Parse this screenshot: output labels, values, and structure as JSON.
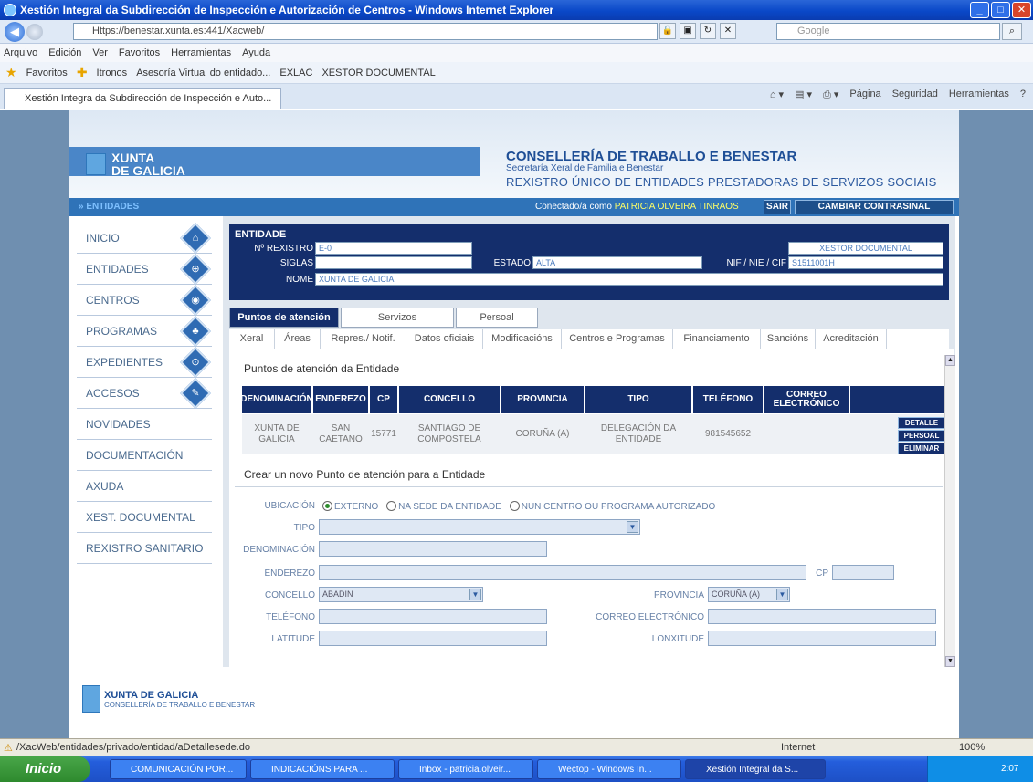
{
  "window": {
    "title": "Xestión Integral da Subdirección de Inspección e Autorización de Centros - Windows Internet Explorer"
  },
  "browser": {
    "url": "Https://benestar.xunta.es:441/Xacweb/",
    "search_placeholder": "Google",
    "menu": [
      "Arquivo",
      "Edición",
      "Ver",
      "Favoritos",
      "Herramientas",
      "Ayuda"
    ],
    "favorites_label": "Favoritos",
    "favorites": [
      "Itronos",
      "Asesoría Virtual do entidado...",
      "EXLAC",
      "XESTOR DOCUMENTAL"
    ],
    "tab_title": "Xestión Integra da Subdirección de Inspección e Auto...",
    "commands": [
      "Página",
      "Seguridad",
      "Herramientas"
    ],
    "status_url": "/XacWeb/entidades/privado/entidad/aDetallesede.do",
    "status_zone": "Internet",
    "status_zoom": "100%"
  },
  "header": {
    "logo_line1": "XUNTA",
    "logo_line2": "DE GALICIA",
    "conselleria": "CONSELLERÍA DE TRABALLO E BENESTAR",
    "secretaria": "Secretaría Xeral de Familia e Benestar",
    "rexistro": "REXISTRO ÚNICO DE ENTIDADES PRESTADORAS DE SERVIZOS SOCIAIS"
  },
  "bluebar": {
    "crumb": "» ENTIDADES",
    "connected_label": "Conectado/a como",
    "user": "PATRICIA OLVEIRA TINRAOS",
    "logout": "SAIR",
    "change_password": "CAMBIAR CONTRASINAL"
  },
  "left_menu": [
    {
      "label": "INICIO",
      "icon": "⌂"
    },
    {
      "label": "ENTIDADES",
      "icon": "⊕"
    },
    {
      "label": "CENTROS",
      "icon": "◉"
    },
    {
      "label": "PROGRAMAS",
      "icon": "♣"
    },
    {
      "label": "EXPEDIENTES",
      "icon": "⊙"
    },
    {
      "label": "ACCESOS",
      "icon": "✎"
    },
    {
      "label": "NOVIDADES",
      "icon": ""
    },
    {
      "label": "DOCUMENTACIÓN",
      "icon": ""
    },
    {
      "label": "AXUDA",
      "icon": ""
    },
    {
      "label": "XEST. DOCUMENTAL",
      "icon": ""
    },
    {
      "label": "REXISTRO SANITARIO",
      "icon": ""
    }
  ],
  "entidade": {
    "title": "ENTIDADE",
    "nrexistro_label": "Nº REXISTRO",
    "nrexistro": "E-0",
    "siglas_label": "SIGLAS",
    "siglas": "",
    "estado_label": "ESTADO",
    "estado": "ALTA",
    "nome_label": "NOME",
    "nome": "XUNTA DE GALICIA",
    "nif_label": "NIF / NIE / CIF",
    "nif": "S1511001H",
    "xestor_label": "XESTOR DOCUMENTAL"
  },
  "tabs_main": [
    "Puntos de atención",
    "Servizos",
    "Persoal"
  ],
  "tabs_sub": [
    "Xeral",
    "Áreas",
    "Repres./ Notif.",
    "Datos oficiais",
    "Modificacións",
    "Centros e Programas",
    "Financiamento",
    "Sancións",
    "Acreditación"
  ],
  "puntos": {
    "section_title": "Puntos de atención da Entidade",
    "columns": [
      "DENOMINACIÓN",
      "ENDEREZO",
      "CP",
      "CONCELLO",
      "PROVINCIA",
      "TIPO",
      "TELÉFONO",
      "CORREO ELECTRÓNICO"
    ],
    "rows": [
      [
        "XUNTA DE GALICIA",
        "SAN CAETANO",
        "15771",
        "SANTIAGO DE COMPOSTELA",
        "CORUÑA (A)",
        "DELEGACIÓN DA ENTIDADE",
        "981545652",
        ""
      ]
    ],
    "actions": [
      "DETALLE",
      "PERSOAL",
      "ELIMINAR"
    ]
  },
  "novo": {
    "section_title": "Crear un novo Punto de atención para a Entidade",
    "ubicacion_label": "UBICACIÓN",
    "ubicacion_options": [
      "EXTERNO",
      "NA SEDE DA ENTIDADE",
      "NUN CENTRO OU PROGRAMA AUTORIZADO"
    ],
    "tipo_label": "TIPO",
    "denominacion_label": "DENOMINACIÓN",
    "enderezo_label": "ENDEREZO",
    "cp_label": "CP",
    "concello_label": "CONCELLO",
    "concello_value": "ABADIN",
    "provincia_label": "PROVINCIA",
    "provincia_value": "CORUÑA (A)",
    "telefono_label": "TELÉFONO",
    "correo_label": "CORREO ELECTRÓNICO",
    "latitude_label": "LATITUDE",
    "lonxitude_label": "LONXITUDE"
  },
  "footer": {
    "line1": "XUNTA DE GALICIA",
    "line2": "CONSELLERÍA DE TRABALLO E BENESTAR"
  },
  "taskbar": {
    "start": "Inicio",
    "tasks": [
      "COMUNICACIÓN POR...",
      "INDICACIÓNS PARA ...",
      "Inbox - patricia.olveir...",
      "Wectop - Windows In...",
      "Xestión Integral da S..."
    ],
    "clock": "2:07"
  },
  "colors": {
    "navy": "#142e6c",
    "accent_blue": "#2f73b8",
    "menu_text": "#4a6a8e"
  }
}
